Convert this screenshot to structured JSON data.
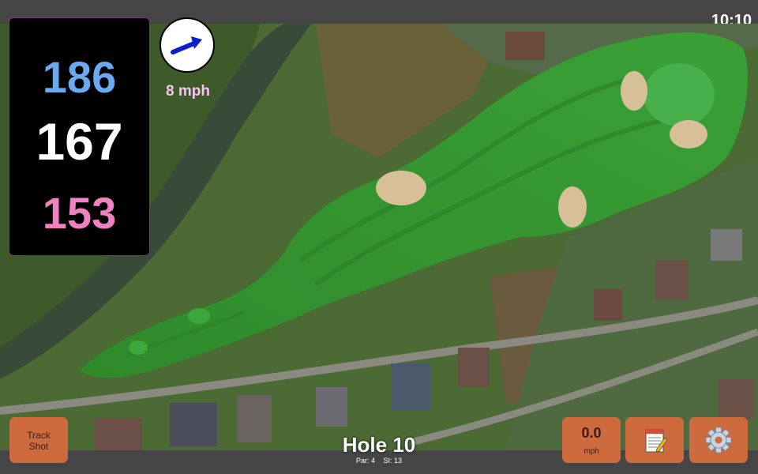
{
  "status": {
    "time": "10:10"
  },
  "distances": {
    "back": "186",
    "center": "167",
    "front": "153"
  },
  "wind": {
    "speed_label": "8 mph",
    "arrow": "arrow-right-up-icon"
  },
  "hole": {
    "title": "Hole 10",
    "par": "Par: 4",
    "stroke_index": "SI: 13"
  },
  "buttons": {
    "track_shot_line1": "Track",
    "track_shot_line2": "Shot",
    "speed_value": "0.0",
    "speed_unit": "mph",
    "notes_icon": "notepad-icon",
    "settings_icon": "gear-icon"
  },
  "colors": {
    "back": "#6aaaf0",
    "center": "#ffffff",
    "front": "#f082c4",
    "button": "#cd6a3e",
    "wind_text": "#f5c5f0"
  }
}
